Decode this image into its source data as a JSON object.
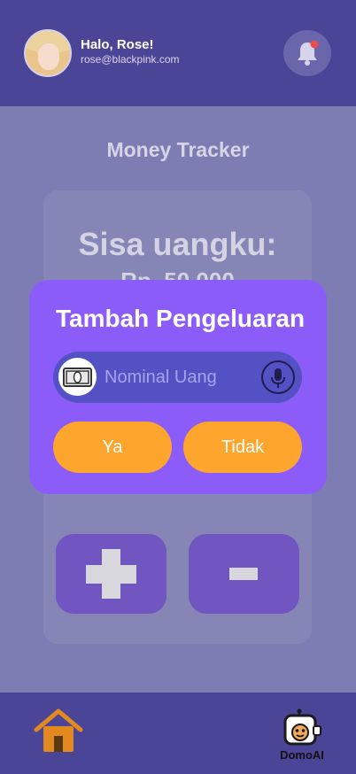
{
  "header": {
    "greeting": "Halo, Rose!",
    "email": "rose@blackpink.com"
  },
  "main": {
    "title": "Money Tracker",
    "balance_label": "Sisa uangku:",
    "balance_value": "Rp. 50.000"
  },
  "dialog": {
    "title": "Tambah Pengeluaran",
    "input_placeholder": "Nominal Uang",
    "input_value": "",
    "yes_label": "Ya",
    "no_label": "Tidak"
  },
  "bottom_nav": {
    "brand": "DomoAI"
  },
  "colors": {
    "header_bg": "#4b4597",
    "dialog_bg": "#8c5cf8",
    "accent_orange": "#fda52c",
    "op_button": "#7155c0"
  },
  "icons": [
    "bell-icon",
    "money-icon",
    "mic-icon",
    "plus-icon",
    "minus-icon",
    "home-icon",
    "robot-icon"
  ]
}
